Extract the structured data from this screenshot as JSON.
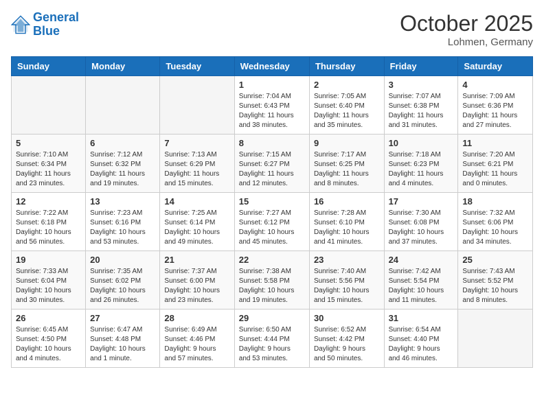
{
  "header": {
    "logo_line1": "General",
    "logo_line2": "Blue",
    "month_title": "October 2025",
    "location": "Lohmen, Germany"
  },
  "weekdays": [
    "Sunday",
    "Monday",
    "Tuesday",
    "Wednesday",
    "Thursday",
    "Friday",
    "Saturday"
  ],
  "weeks": [
    [
      {
        "day": "",
        "info": ""
      },
      {
        "day": "",
        "info": ""
      },
      {
        "day": "",
        "info": ""
      },
      {
        "day": "1",
        "info": "Sunrise: 7:04 AM\nSunset: 6:43 PM\nDaylight: 11 hours\nand 38 minutes."
      },
      {
        "day": "2",
        "info": "Sunrise: 7:05 AM\nSunset: 6:40 PM\nDaylight: 11 hours\nand 35 minutes."
      },
      {
        "day": "3",
        "info": "Sunrise: 7:07 AM\nSunset: 6:38 PM\nDaylight: 11 hours\nand 31 minutes."
      },
      {
        "day": "4",
        "info": "Sunrise: 7:09 AM\nSunset: 6:36 PM\nDaylight: 11 hours\nand 27 minutes."
      }
    ],
    [
      {
        "day": "5",
        "info": "Sunrise: 7:10 AM\nSunset: 6:34 PM\nDaylight: 11 hours\nand 23 minutes."
      },
      {
        "day": "6",
        "info": "Sunrise: 7:12 AM\nSunset: 6:32 PM\nDaylight: 11 hours\nand 19 minutes."
      },
      {
        "day": "7",
        "info": "Sunrise: 7:13 AM\nSunset: 6:29 PM\nDaylight: 11 hours\nand 15 minutes."
      },
      {
        "day": "8",
        "info": "Sunrise: 7:15 AM\nSunset: 6:27 PM\nDaylight: 11 hours\nand 12 minutes."
      },
      {
        "day": "9",
        "info": "Sunrise: 7:17 AM\nSunset: 6:25 PM\nDaylight: 11 hours\nand 8 minutes."
      },
      {
        "day": "10",
        "info": "Sunrise: 7:18 AM\nSunset: 6:23 PM\nDaylight: 11 hours\nand 4 minutes."
      },
      {
        "day": "11",
        "info": "Sunrise: 7:20 AM\nSunset: 6:21 PM\nDaylight: 11 hours\nand 0 minutes."
      }
    ],
    [
      {
        "day": "12",
        "info": "Sunrise: 7:22 AM\nSunset: 6:18 PM\nDaylight: 10 hours\nand 56 minutes."
      },
      {
        "day": "13",
        "info": "Sunrise: 7:23 AM\nSunset: 6:16 PM\nDaylight: 10 hours\nand 53 minutes."
      },
      {
        "day": "14",
        "info": "Sunrise: 7:25 AM\nSunset: 6:14 PM\nDaylight: 10 hours\nand 49 minutes."
      },
      {
        "day": "15",
        "info": "Sunrise: 7:27 AM\nSunset: 6:12 PM\nDaylight: 10 hours\nand 45 minutes."
      },
      {
        "day": "16",
        "info": "Sunrise: 7:28 AM\nSunset: 6:10 PM\nDaylight: 10 hours\nand 41 minutes."
      },
      {
        "day": "17",
        "info": "Sunrise: 7:30 AM\nSunset: 6:08 PM\nDaylight: 10 hours\nand 37 minutes."
      },
      {
        "day": "18",
        "info": "Sunrise: 7:32 AM\nSunset: 6:06 PM\nDaylight: 10 hours\nand 34 minutes."
      }
    ],
    [
      {
        "day": "19",
        "info": "Sunrise: 7:33 AM\nSunset: 6:04 PM\nDaylight: 10 hours\nand 30 minutes."
      },
      {
        "day": "20",
        "info": "Sunrise: 7:35 AM\nSunset: 6:02 PM\nDaylight: 10 hours\nand 26 minutes."
      },
      {
        "day": "21",
        "info": "Sunrise: 7:37 AM\nSunset: 6:00 PM\nDaylight: 10 hours\nand 23 minutes."
      },
      {
        "day": "22",
        "info": "Sunrise: 7:38 AM\nSunset: 5:58 PM\nDaylight: 10 hours\nand 19 minutes."
      },
      {
        "day": "23",
        "info": "Sunrise: 7:40 AM\nSunset: 5:56 PM\nDaylight: 10 hours\nand 15 minutes."
      },
      {
        "day": "24",
        "info": "Sunrise: 7:42 AM\nSunset: 5:54 PM\nDaylight: 10 hours\nand 11 minutes."
      },
      {
        "day": "25",
        "info": "Sunrise: 7:43 AM\nSunset: 5:52 PM\nDaylight: 10 hours\nand 8 minutes."
      }
    ],
    [
      {
        "day": "26",
        "info": "Sunrise: 6:45 AM\nSunset: 4:50 PM\nDaylight: 10 hours\nand 4 minutes."
      },
      {
        "day": "27",
        "info": "Sunrise: 6:47 AM\nSunset: 4:48 PM\nDaylight: 10 hours\nand 1 minute."
      },
      {
        "day": "28",
        "info": "Sunrise: 6:49 AM\nSunset: 4:46 PM\nDaylight: 9 hours\nand 57 minutes."
      },
      {
        "day": "29",
        "info": "Sunrise: 6:50 AM\nSunset: 4:44 PM\nDaylight: 9 hours\nand 53 minutes."
      },
      {
        "day": "30",
        "info": "Sunrise: 6:52 AM\nSunset: 4:42 PM\nDaylight: 9 hours\nand 50 minutes."
      },
      {
        "day": "31",
        "info": "Sunrise: 6:54 AM\nSunset: 4:40 PM\nDaylight: 9 hours\nand 46 minutes."
      },
      {
        "day": "",
        "info": ""
      }
    ]
  ]
}
